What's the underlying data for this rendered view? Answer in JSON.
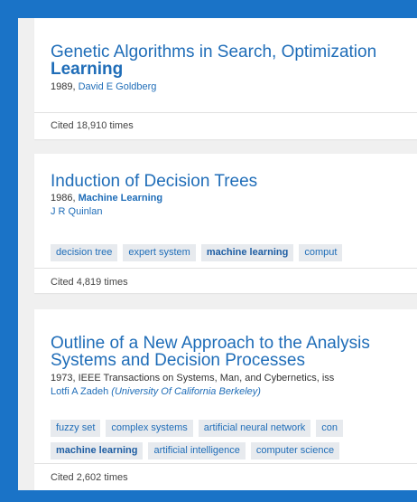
{
  "results": [
    {
      "title_line1": "Genetic Algorithms in Search, Optimization",
      "title_line2": "Learning",
      "year_prefix": "1989,",
      "author": "David E Goldberg",
      "cited": "Cited 18,910 times"
    },
    {
      "title": "Induction of Decision Trees",
      "year_prefix": "1986,",
      "venue": "Machine Learning",
      "author": "J R Quinlan",
      "tags": [
        "decision tree",
        "expert system",
        "machine learning",
        "comput"
      ],
      "cited": "Cited 4,819 times"
    },
    {
      "title_line1": "Outline of a New Approach to the Analysis",
      "title_line2": "Systems and Decision Processes",
      "year_venue": "1973, IEEE Transactions on Systems, Man, and Cybernetics, iss",
      "author": "Lotfi A Zadeh",
      "affiliation": "(University Of California Berkeley)",
      "tags_row1": [
        "fuzzy set",
        "complex systems",
        "artificial neural network",
        "con"
      ],
      "tags_row2": [
        "machine learning",
        "artificial intelligence",
        "computer science"
      ],
      "cited": "Cited 2,602 times"
    }
  ]
}
